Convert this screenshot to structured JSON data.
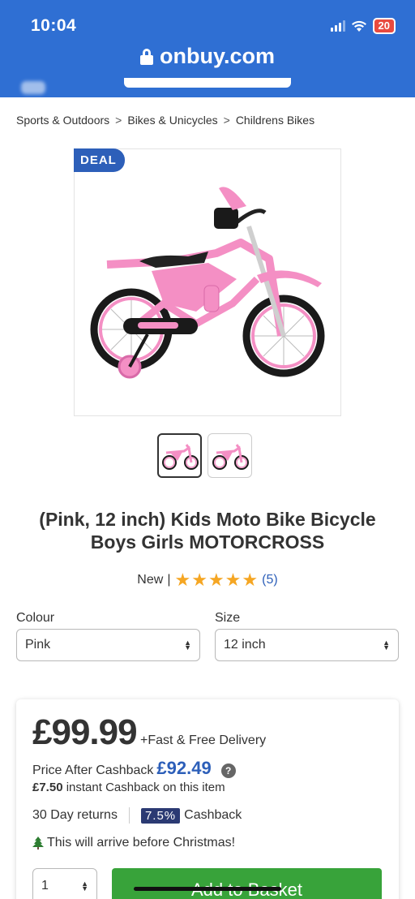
{
  "status_bar": {
    "time": "10:04",
    "battery": "20"
  },
  "browser": {
    "url": "onbuy.com"
  },
  "breadcrumb": {
    "items": [
      "Sports & Outdoors",
      "Bikes & Unicycles",
      "Childrens Bikes"
    ],
    "separator": ">"
  },
  "product": {
    "badge": "DEAL",
    "title": "(Pink, 12 inch) Kids Moto Bike Bicycle Boys Girls MOTORCROSS",
    "condition": "New",
    "divider": "|",
    "rating_stars": 5,
    "review_count": "(5)"
  },
  "options": {
    "colour_label": "Colour",
    "colour_value": "Pink",
    "size_label": "Size",
    "size_value": "12 inch"
  },
  "pricing": {
    "price": "£99.99",
    "delivery": "+Fast & Free Delivery",
    "after_cashback_label": "Price After Cashback",
    "after_cashback_value": "£92.49",
    "help_icon": "?",
    "instant_amount": "£7.50",
    "instant_text": "instant Cashback on this item",
    "returns": "30 Day returns",
    "cashback_percent": "7.5%",
    "cashback_label": "Cashback",
    "christmas": "This will arrive before Christmas!",
    "quantity": "1",
    "add_to_basket": "Add to Basket"
  },
  "colors": {
    "header_blue": "#2f6fd3",
    "brand_blue": "#2d5fb9",
    "cashback_navy": "#2b3a73",
    "basket_green": "#38a33a",
    "star_orange": "#f5a623",
    "bike_pink": "#f48fc4"
  }
}
